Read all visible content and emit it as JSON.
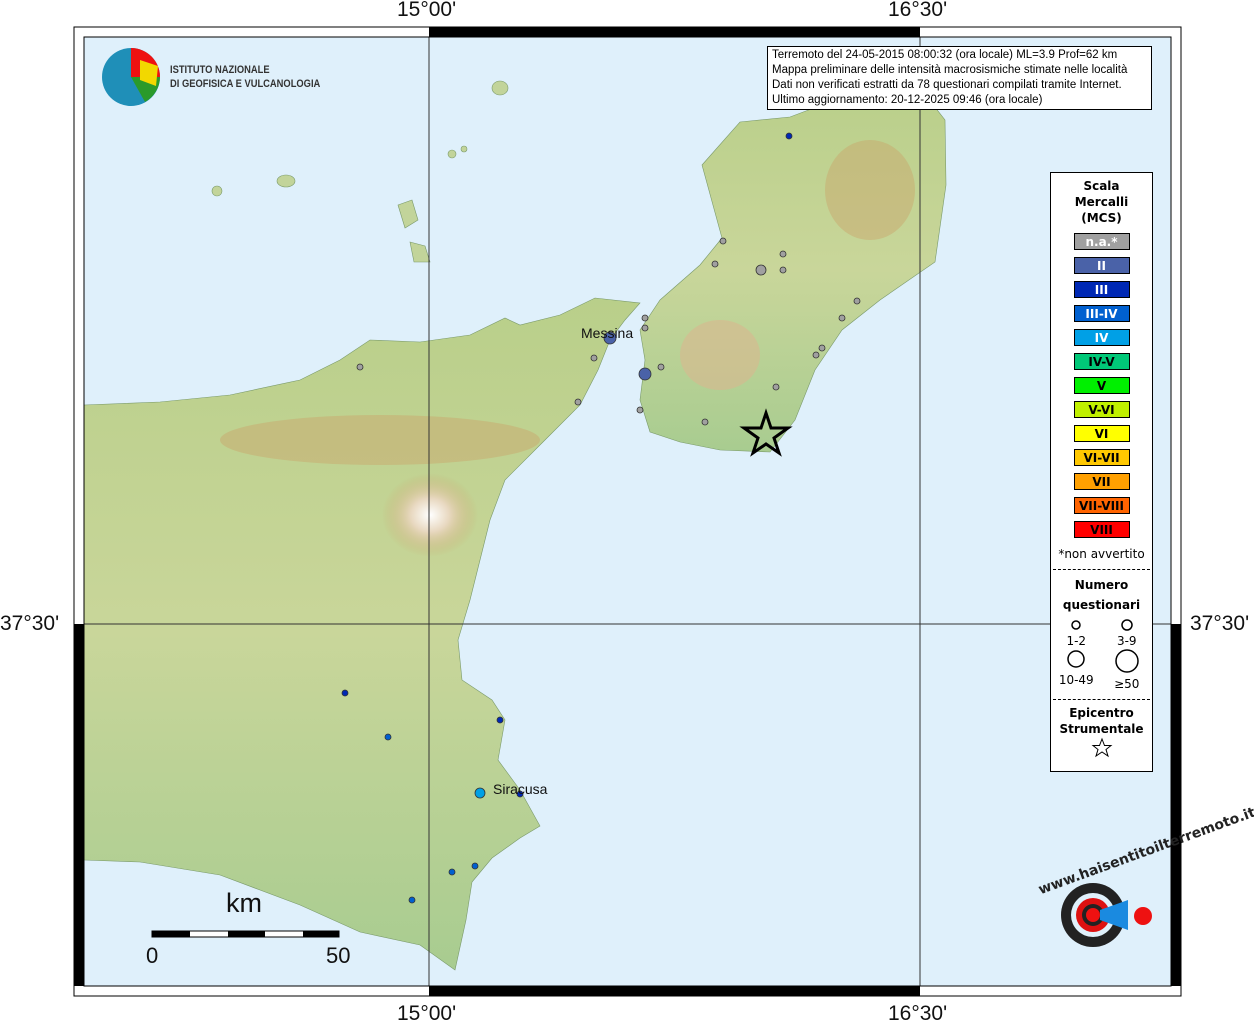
{
  "coordinates": {
    "lon_left": "15°00'",
    "lon_right": "16°30'",
    "lat": "37°30'"
  },
  "info": {
    "lines": [
      "Terremoto del 24-05-2015 08:00:32 (ora locale) ML=3.9 Prof=62 km",
      "Mappa preliminare delle intensità macrosismiche stimate nelle località",
      "Dati non verificati estratti da 78 questionari compilati tramite Internet.",
      "Ultimo aggiornamento: 20-12-2025 09:46 (ora locale)"
    ]
  },
  "logo_ingv": {
    "line1": "ISTITUTO NAZIONALE",
    "line2": "DI GEOFISICA E VULCANOLOGIA"
  },
  "logo_hsit": {
    "text": "www.haisentitoilterremoto.it"
  },
  "cities": {
    "messina": "Messina",
    "siracusa": "Siracusa"
  },
  "scale_bar": {
    "unit": "km",
    "start": "0",
    "end": "50"
  },
  "legend": {
    "title": [
      "Scala",
      "Mercalli",
      "(MCS)"
    ],
    "levels": [
      {
        "label": "n.a.*",
        "color": "#a0a0a0",
        "text": "#fff"
      },
      {
        "label": "II",
        "color": "#4a62a8",
        "text": "#fff"
      },
      {
        "label": "III",
        "color": "#0028b4",
        "text": "#fff"
      },
      {
        "label": "III-IV",
        "color": "#0060d0",
        "text": "#fff"
      },
      {
        "label": "IV",
        "color": "#00a0e6",
        "text": "#fff"
      },
      {
        "label": "IV-V",
        "color": "#00c878",
        "text": "#000"
      },
      {
        "label": "V",
        "color": "#00f000",
        "text": "#000"
      },
      {
        "label": "V-VI",
        "color": "#c0f000",
        "text": "#000"
      },
      {
        "label": "VI",
        "color": "#ffff00",
        "text": "#000"
      },
      {
        "label": "VI-VII",
        "color": "#ffc800",
        "text": "#000"
      },
      {
        "label": "VII",
        "color": "#ffa000",
        "text": "#000"
      },
      {
        "label": "VII-VIII",
        "color": "#ff6400",
        "text": "#000"
      },
      {
        "label": "VIII",
        "color": "#ff0000",
        "text": "#000"
      }
    ],
    "na_note": "*non avvertito",
    "count_title": [
      "Numero",
      "questionari"
    ],
    "counts": [
      "1-2",
      "3-9",
      "10-49",
      "≥50"
    ],
    "epicenter_title": [
      "Epicentro",
      "Strumentale"
    ]
  }
}
